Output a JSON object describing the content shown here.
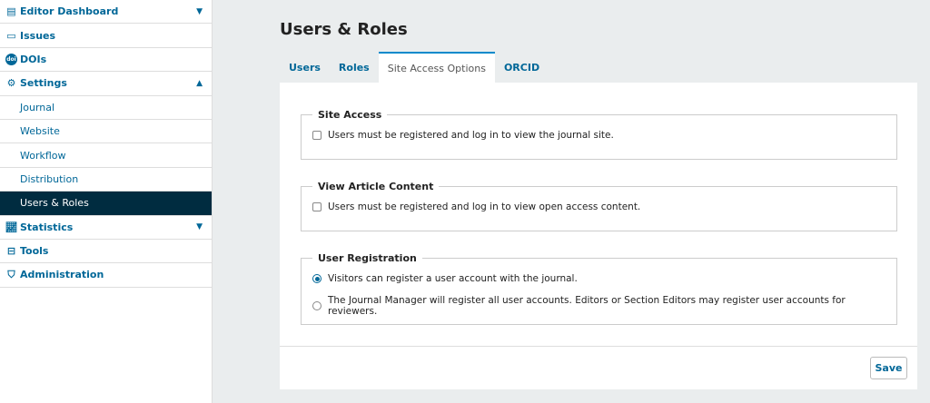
{
  "sidebar": {
    "items": [
      {
        "label": "Editor Dashboard",
        "icon": "dashboard-icon"
      },
      {
        "label": "Issues",
        "icon": "issues-icon"
      },
      {
        "label": "DOIs",
        "icon": "doi-icon"
      },
      {
        "label": "Settings",
        "icon": "gear-icon"
      },
      {
        "label": "Journal"
      },
      {
        "label": "Website"
      },
      {
        "label": "Workflow"
      },
      {
        "label": "Distribution"
      },
      {
        "label": "Users & Roles"
      },
      {
        "label": "Statistics",
        "icon": "chart-icon"
      },
      {
        "label": "Tools",
        "icon": "toolbox-icon"
      },
      {
        "label": "Administration",
        "icon": "admin-icon"
      }
    ]
  },
  "page": {
    "title": "Users & Roles"
  },
  "tabs": [
    "Users",
    "Roles",
    "Site Access Options",
    "ORCID"
  ],
  "site_access": {
    "legend": "Site Access",
    "option": "Users must be registered and log in to view the journal site."
  },
  "article": {
    "legend": "View Article Content",
    "option": "Users must be registered and log in to view open access content."
  },
  "registration": {
    "legend": "User Registration",
    "options": [
      "Visitors can register a user account with the journal.",
      "The Journal Manager will register all user accounts. Editors or Section Editors may register user accounts for reviewers."
    ]
  },
  "save_label": "Save"
}
